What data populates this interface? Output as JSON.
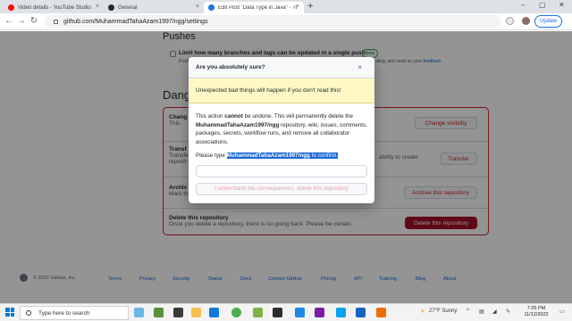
{
  "browser": {
    "tabs": [
      {
        "title": "Video details - YouTube Studio",
        "color": "#ff0000"
      },
      {
        "title": "General",
        "color": "#24292f"
      },
      {
        "title": "Edit Post \"Data Type in Java\" - Tut",
        "color": "#1a73e8"
      }
    ],
    "url": "github.com/MuhammadTahaAzam1997/ngg/settings",
    "update_label": "Update"
  },
  "page": {
    "pushes_heading": "Pushes",
    "pushes_label": "Limit how many branches and tags can be updated in a single push",
    "beta": "Beta",
    "pushes_desc_a": "Pushe",
    "pushes_desc_b": "ating, and send us your",
    "pushes_feedback": "feedback",
    "danger_heading": "Dange",
    "rows": [
      {
        "title": "Chang",
        "desc": "This",
        "button": "Change visibility"
      },
      {
        "title": "Transf",
        "desc": "Transfe",
        "desc2": "ability to create",
        "desc3": "reposit",
        "button": "Transfer"
      },
      {
        "title": "Archiv",
        "desc": "Mark th",
        "button": "Archive this repository"
      },
      {
        "title": "Delete this repository",
        "desc": "Once you delete a repository, there is no going back. Please be certain.",
        "button": "Delete this repository"
      }
    ]
  },
  "modal": {
    "title": "Are you absolutely sure?",
    "close": "×",
    "warning": "Unexpected bad things will happen if you don't read this!",
    "body_pre": "This action ",
    "body_bold": "cannot",
    "body_mid": " be undone. This will permanently delete the ",
    "repo": "MuhammadTahaAzam1997/ngg",
    "body_post": " repository, wiki, issues, comments, packages, secrets, workflow runs, and remove all collaborator associations.",
    "type_prefix": "Please type ",
    "type_target": "MuhammadTahaAzam1997/ngg",
    "type_suffix": " to confirm.",
    "input_value": "",
    "confirm_button": "I understand the consequences, delete this repository"
  },
  "footer": {
    "copyright": "© 2022 GitHub, Inc.",
    "links": [
      "Terms",
      "Privacy",
      "Security",
      "Status",
      "Docs",
      "Contact GitHub",
      "Pricing",
      "API",
      "Training",
      "Blog",
      "About"
    ]
  },
  "taskbar": {
    "search_placeholder": "Type here to search",
    "weather": "27°F Sunny",
    "time": "7:25 PM",
    "date": "11/12/2022"
  },
  "colors": {
    "danger": "#cf222e",
    "warning_bg": "#fff8c5",
    "highlight": "#1967d2"
  }
}
